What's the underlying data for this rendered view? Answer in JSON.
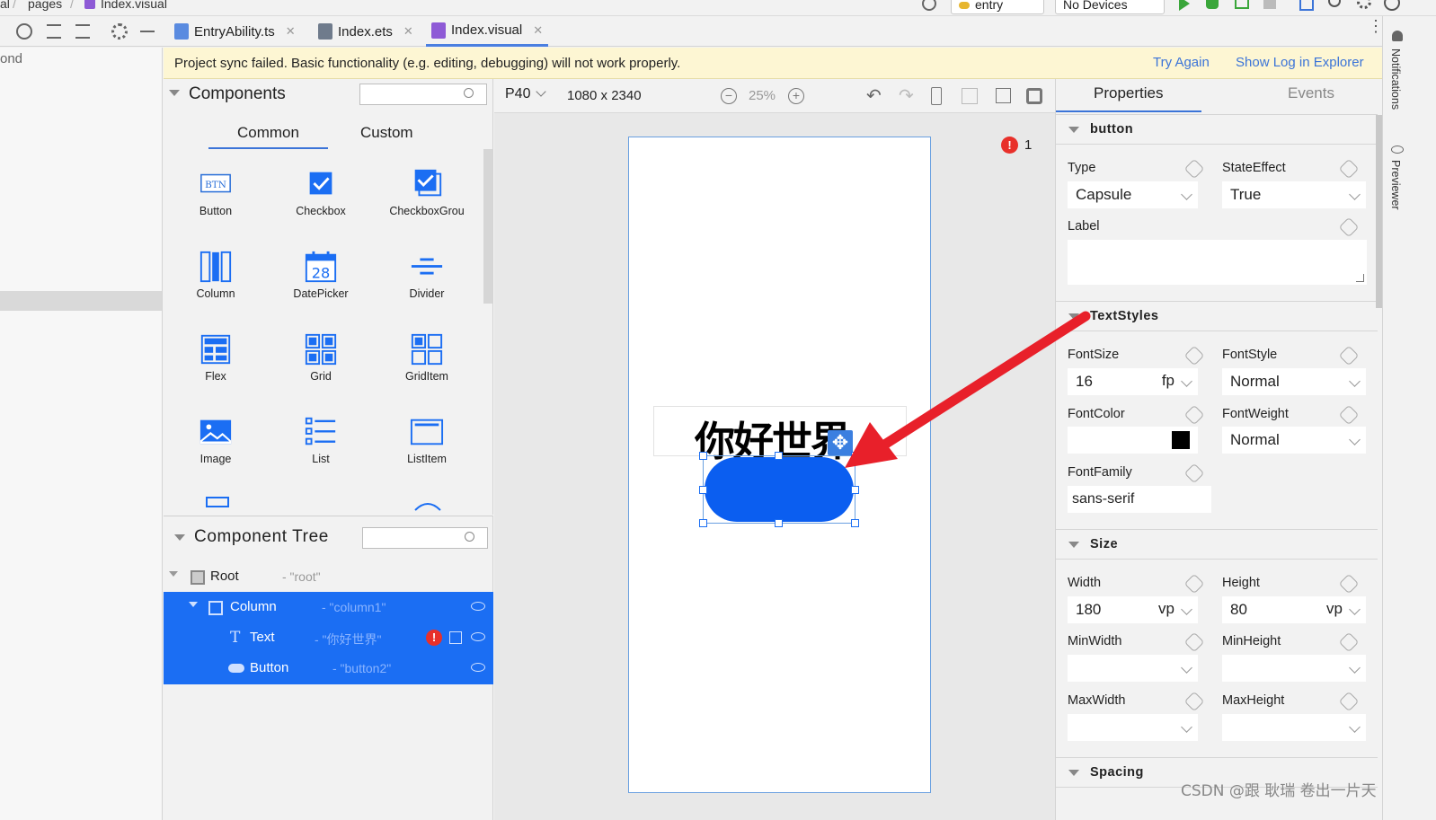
{
  "topbar": {
    "crumb_a": "al",
    "crumb_b": "pages",
    "crumb_c": "Index.visual",
    "run_config": "entry",
    "device": "No Devices"
  },
  "tabs": [
    {
      "label": "EntryAbility.ts",
      "icon": "ts-file-icon"
    },
    {
      "label": "Index.ets",
      "icon": "ets-file-icon"
    },
    {
      "label": "Index.visual",
      "icon": "visual-file-icon"
    }
  ],
  "banner": {
    "message": "Project sync failed. Basic functionality (e.g. editing, debugging) will not work properly.",
    "try_again": "Try Again",
    "show_log": "Show Log in Explorer"
  },
  "project": {
    "partial_label": "ond"
  },
  "components": {
    "title": "Components",
    "tab_common": "Common",
    "tab_custom": "Custom",
    "items": [
      {
        "label": "Button",
        "icon": "button-icon"
      },
      {
        "label": "Checkbox",
        "icon": "checkbox-icon"
      },
      {
        "label": "CheckboxGrou",
        "icon": "checkbox-group-icon"
      },
      {
        "label": "Column",
        "icon": "column-icon"
      },
      {
        "label": "DatePicker",
        "icon": "datepicker-icon",
        "day": "28"
      },
      {
        "label": "Divider",
        "icon": "divider-icon"
      },
      {
        "label": "Flex",
        "icon": "flex-icon"
      },
      {
        "label": "Grid",
        "icon": "grid-icon"
      },
      {
        "label": "GridItem",
        "icon": "griditem-icon"
      },
      {
        "label": "Image",
        "icon": "image-icon"
      },
      {
        "label": "List",
        "icon": "list-icon"
      },
      {
        "label": "ListItem",
        "icon": "listitem-icon"
      }
    ],
    "button_icon_text": "BTN"
  },
  "tree": {
    "title": "Component Tree",
    "rows": [
      {
        "name": "Root",
        "id": "- \"root\""
      },
      {
        "name": "Column",
        "id": "- \"column1\""
      },
      {
        "name": "Text",
        "id": "- \"你好世界\""
      },
      {
        "name": "Button",
        "id": "- \"button2\""
      }
    ]
  },
  "canvas": {
    "device": "P40",
    "resolution": "1080 x 2340",
    "zoom": "25%",
    "error_count": "1",
    "text_content": "你好世界"
  },
  "props": {
    "tab_properties": "Properties",
    "tab_events": "Events",
    "section_button": "button",
    "type_label": "Type",
    "type_value": "Capsule",
    "stateeffect_label": "StateEffect",
    "stateeffect_value": "True",
    "label_label": "Label",
    "section_textstyles": "TextStyles",
    "fontsize_label": "FontSize",
    "fontsize_value": "16",
    "fontsize_unit": "fp",
    "fontstyle_label": "FontStyle",
    "fontstyle_value": "Normal",
    "fontcolor_label": "FontColor",
    "fontcolor_value": "#000000",
    "fontweight_label": "FontWeight",
    "fontweight_value": "Normal",
    "fontfamily_label": "FontFamily",
    "fontfamily_value": "sans-serif",
    "section_size": "Size",
    "width_label": "Width",
    "width_value": "180",
    "width_unit": "vp",
    "height_label": "Height",
    "height_value": "80",
    "height_unit": "vp",
    "minwidth_label": "MinWidth",
    "minheight_label": "MinHeight",
    "maxwidth_label": "MaxWidth",
    "maxheight_label": "MaxHeight",
    "section_spacing": "Spacing"
  },
  "rstrip": {
    "notifications": "Notifications",
    "previewer": "Previewer"
  },
  "watermark": "CSDN @跟 耿瑞 卷出一片天",
  "colors": {
    "accent": "#1b6ef3",
    "button_blue": "#0b5ef0",
    "banner_bg": "#fdf6d3",
    "arrow_red": "#e8202a",
    "link": "#3b74d8"
  }
}
